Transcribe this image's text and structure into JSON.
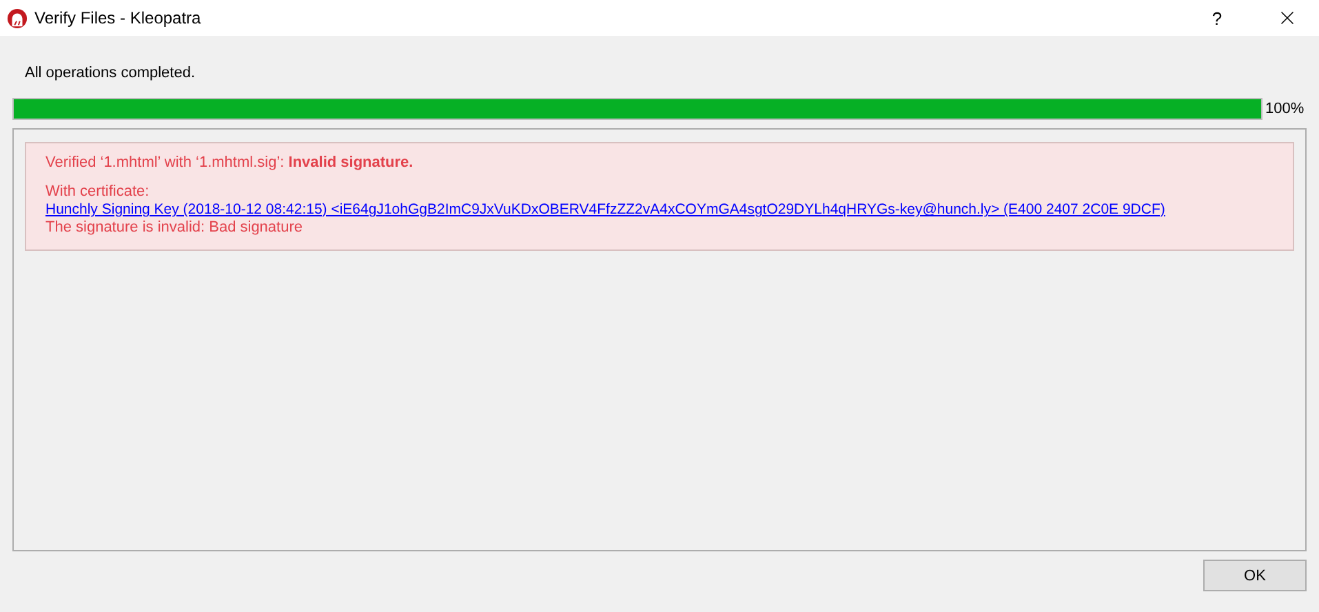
{
  "window": {
    "title": "Verify Files - Kleopatra",
    "help_button": "?"
  },
  "status": "All operations completed.",
  "progress": {
    "level": 1,
    "reading": "100%"
  },
  "result": {
    "summary": "Verified ‘1.mhtml’ with ‘1.mhtml.sig’: **Invalid signature.**",
    "certificate_label": "With certificate:",
    "certificate_link": "Hunchly Signing Key (2018-10-12 08:42:15) <iE64gJ1ohGgB2ImC9JxVuKDxOBERV4FfzZZ2vA4xCOYmGA4sgtO29DYLh4qHRYGs-key@hunch.ly> (E400 2407 2C0E 9DCF)",
    "detail": "The signature is invalid: Bad signature"
  },
  "buttons": [
    "OK"
  ]
}
